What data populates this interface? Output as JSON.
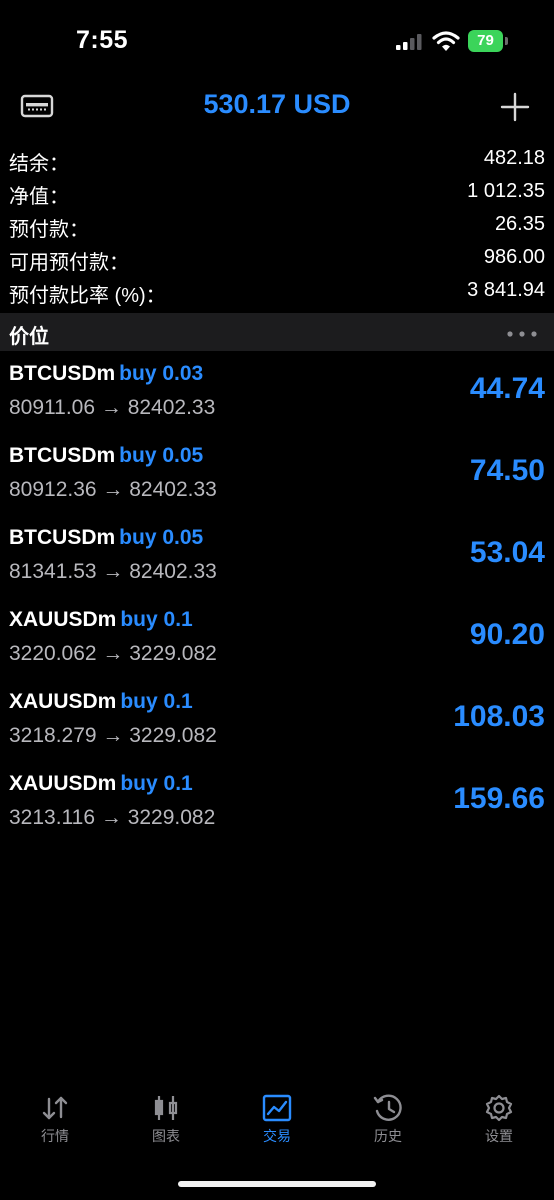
{
  "status_bar": {
    "time": "7:55",
    "battery_level": "79",
    "battery_color": "#3bd45a"
  },
  "header": {
    "title": "530.17 USD",
    "left_icon": "card-icon",
    "right_icon": "plus-icon"
  },
  "summary": [
    {
      "label": "结余：",
      "value": "482.18"
    },
    {
      "label": "净值：",
      "value": "1 012.35"
    },
    {
      "label": "预付款：",
      "value": "26.35"
    },
    {
      "label": "可用预付款：",
      "value": "986.00"
    },
    {
      "label": "预付款比率 (%)：",
      "value": "3 841.94"
    }
  ],
  "section": {
    "title": "价位",
    "menu_icon": "more-icon"
  },
  "positions": [
    {
      "symbol": "BTCUSDm",
      "side": "buy 0.03",
      "prices": "80911.06 → 82402.33",
      "profit": "44.74"
    },
    {
      "symbol": "BTCUSDm",
      "side": "buy 0.05",
      "prices": "80912.36 → 82402.33",
      "profit": "74.50"
    },
    {
      "symbol": "BTCUSDm",
      "side": "buy 0.05",
      "prices": "81341.53 → 82402.33",
      "profit": "53.04"
    },
    {
      "symbol": "XAUUSDm",
      "side": "buy 0.1",
      "prices": "3220.062 → 3229.082",
      "profit": "90.20"
    },
    {
      "symbol": "XAUUSDm",
      "side": "buy 0.1",
      "prices": "3218.279 → 3229.082",
      "profit": "108.03"
    },
    {
      "symbol": "XAUUSDm",
      "side": "buy 0.1",
      "prices": "3213.116 → 3229.082",
      "profit": "159.66"
    }
  ],
  "tabs": [
    {
      "label": "行情",
      "icon": "quotes-icon",
      "active": false
    },
    {
      "label": "图表",
      "icon": "chart-icon",
      "active": false
    },
    {
      "label": "交易",
      "icon": "trade-icon",
      "active": true
    },
    {
      "label": "历史",
      "icon": "history-icon",
      "active": false
    },
    {
      "label": "设置",
      "icon": "settings-icon",
      "active": false
    }
  ],
  "colors": {
    "accent": "#2a8cff",
    "background": "#000000",
    "section_bg": "#1c1c1e",
    "secondary_text": "#b8b8bd",
    "tab_inactive": "#8e8e93"
  }
}
